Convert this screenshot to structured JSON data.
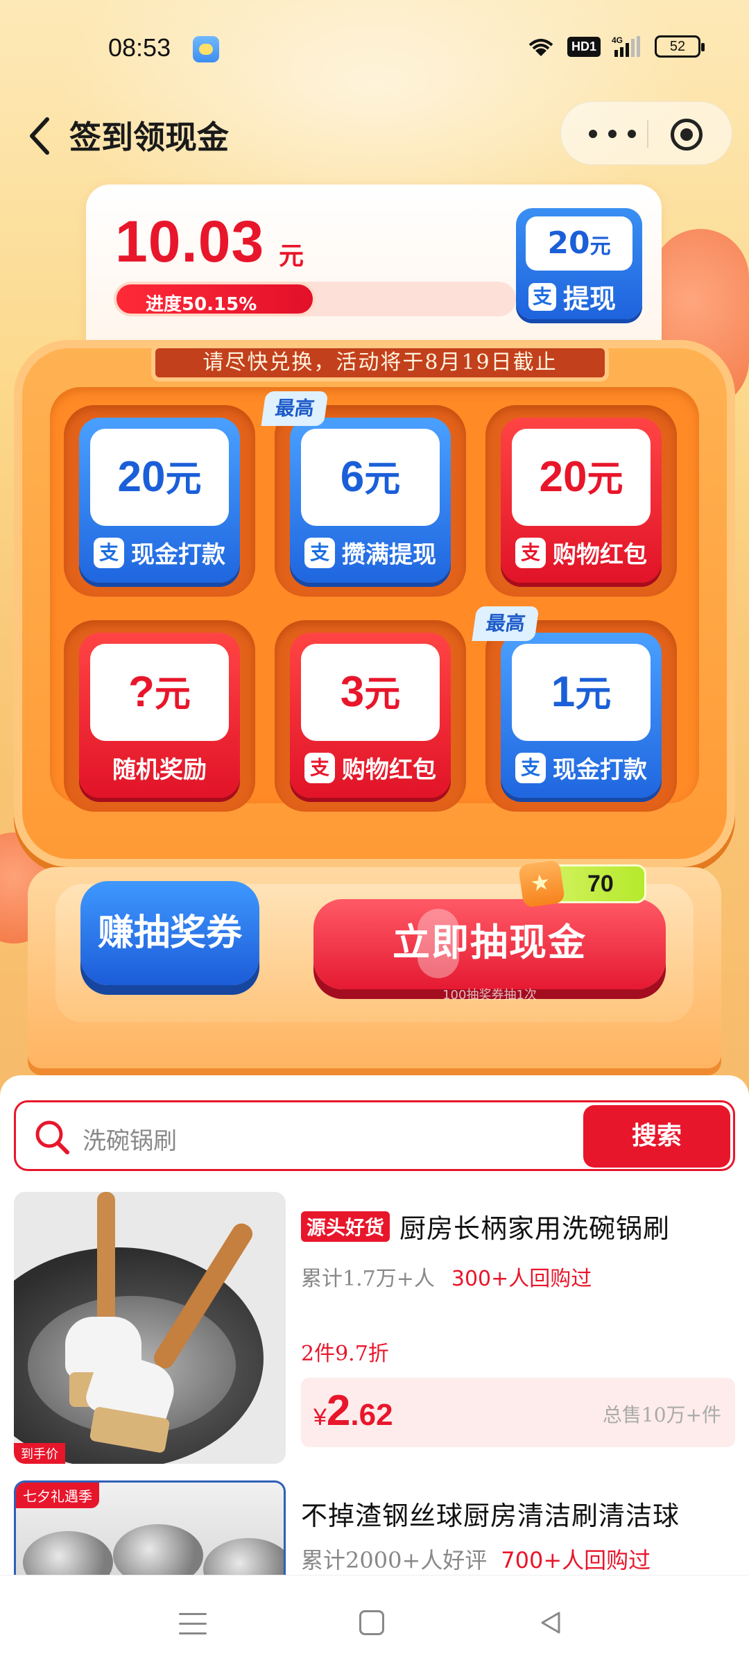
{
  "status_bar": {
    "time": "08:53",
    "hd_label": "HD1",
    "battery": "52"
  },
  "header": {
    "title": "签到领现金"
  },
  "balance": {
    "amount": "10.03",
    "unit": "元",
    "progress_label": "进度50.15%",
    "progress_percent": 50.15,
    "withdraw": {
      "amount": "20",
      "unit": "元",
      "label": "提现",
      "icon": "支"
    }
  },
  "machine": {
    "deadline": "请尽快兑换，活动将于8月19日截止",
    "max_tag": "最高",
    "tiles": [
      {
        "amount": "20",
        "unit": "元",
        "label": "现金打款",
        "color": "blue",
        "alipay": true,
        "max": false
      },
      {
        "amount": "6",
        "unit": "元",
        "label": "攒满提现",
        "color": "blue",
        "alipay": true,
        "max": true
      },
      {
        "amount": "20",
        "unit": "元",
        "label": "购物红包",
        "color": "red",
        "alipay": true,
        "max": false
      },
      {
        "amount": "?",
        "unit": "元",
        "label": "随机奖励",
        "color": "red",
        "alipay": false,
        "max": false
      },
      {
        "amount": "3",
        "unit": "元",
        "label": "购物红包",
        "color": "red",
        "alipay": true,
        "max": false
      },
      {
        "amount": "1",
        "unit": "元",
        "label": "现金打款",
        "color": "blue",
        "alipay": true,
        "max": true
      }
    ],
    "earn_button": "赚抽奖券",
    "draw_button": "立即抽现金",
    "draw_count": "70",
    "draw_subtext": "100抽奖券抽1次"
  },
  "search": {
    "placeholder": "洗碗锅刷",
    "button": "搜索"
  },
  "products": [
    {
      "badge": "源头好货",
      "title": "厨房长柄家用洗碗锅刷",
      "sub": "累计1.7万+人",
      "repurchase": "300+人回购过",
      "discount": "2件9.7折",
      "price_currency": "¥",
      "price_int": "2",
      "price_dec": ".62",
      "total_sales": "总售10万+件",
      "img_corner": "到手价"
    },
    {
      "season_tag": "七夕礼遇季",
      "title": "不掉渣钢丝球厨房清洁刷清洁球",
      "sub": "累计2000+人好评",
      "repurchase": "700+人回购过"
    }
  ],
  "colors": {
    "brand_red": "#e8162b",
    "brand_blue": "#1b5fd8",
    "machine_orange": "#ff9a35"
  }
}
